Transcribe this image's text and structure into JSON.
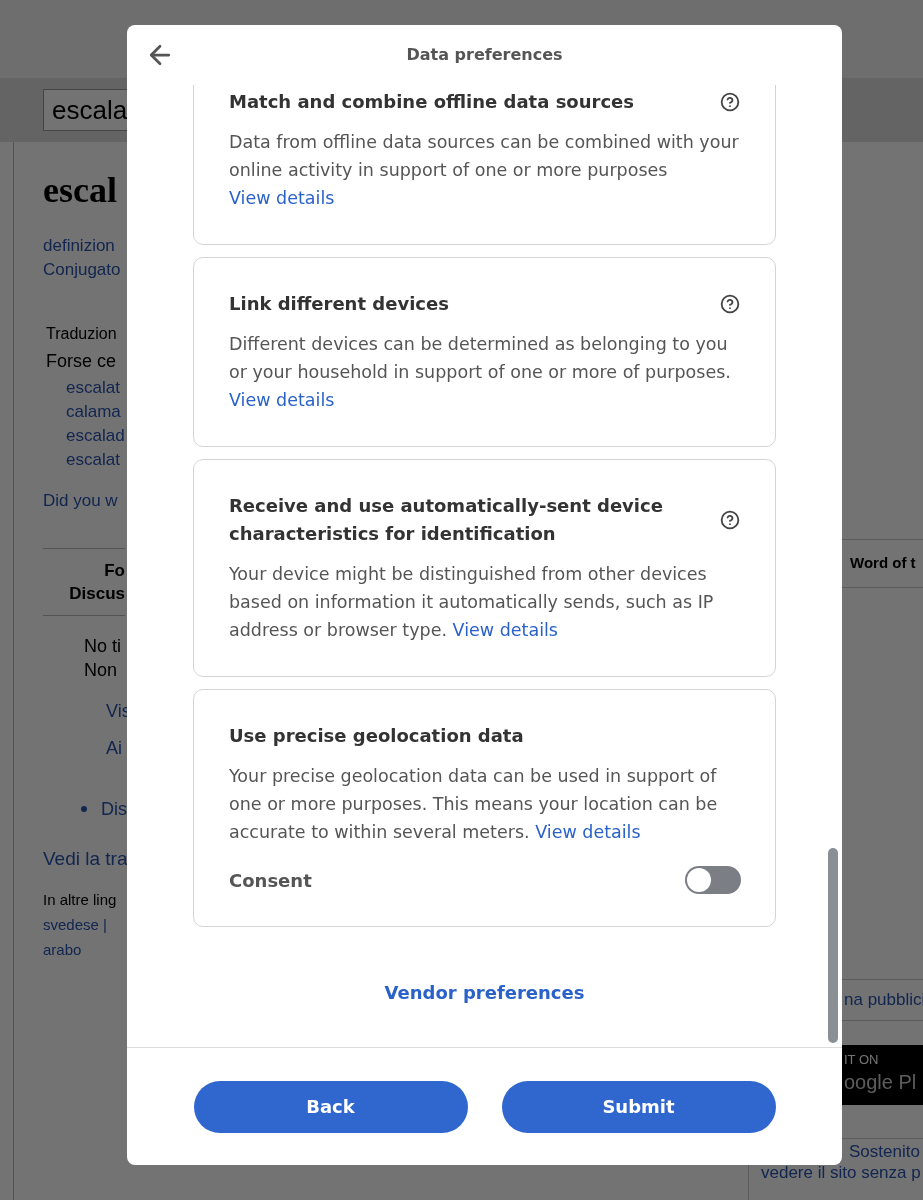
{
  "page": {
    "search_value": "escala",
    "heading": "escal",
    "links": [
      "definizion",
      "Conjugato"
    ],
    "translation_label": "Traduzion",
    "suggest_label": "Forse ce",
    "suggestions": [
      "escalat",
      "calama",
      "escalad",
      "escalat"
    ],
    "did_you_mean": "Did you w",
    "table_header": [
      "Fo",
      "Discus"
    ],
    "notice": [
      "No ti",
      "Non"
    ],
    "actions": [
      "Vis",
      "Ai"
    ],
    "bullet": "Dis",
    "see_translation": "Vedi la tra",
    "other_languages_label": "In altre ling",
    "languages": [
      "svedese |",
      "arabo"
    ]
  },
  "sidebar": {
    "word_of_day": "Word of t",
    "ad_link": "na pubblici",
    "store_badge": [
      "IT ON",
      "oogle Pl"
    ],
    "supporter_link": "Sostenito",
    "supporter_text": "vedere il sito senza p"
  },
  "dialog": {
    "title": "Data preferences",
    "cards": [
      {
        "title": "Match and combine offline data sources",
        "description": "Data from offline data sources can be combined with your online activity in support of one or more purposes",
        "link": "View details",
        "help": true
      },
      {
        "title": "Link different devices",
        "description": "Different devices can be determined as belonging to you or your household in support of one or more of purposes.",
        "link": "View details",
        "help": true
      },
      {
        "title": "Receive and use automatically-sent device characteristics for identification",
        "description": "Your device might be distinguished from other devices based on information it automatically sends, such as IP address or browser type.",
        "link": "View details",
        "help": true
      },
      {
        "title": "Use precise geolocation data",
        "description": "Your precise geolocation data can be used in support of one or more purposes. This means your location can be accurate to within several meters.",
        "link": "View details",
        "help": false,
        "consent": {
          "label": "Consent",
          "on": false
        }
      }
    ],
    "vendor_link": "Vendor preferences",
    "buttons": [
      {
        "label": "Back"
      },
      {
        "label": "Submit"
      }
    ]
  }
}
